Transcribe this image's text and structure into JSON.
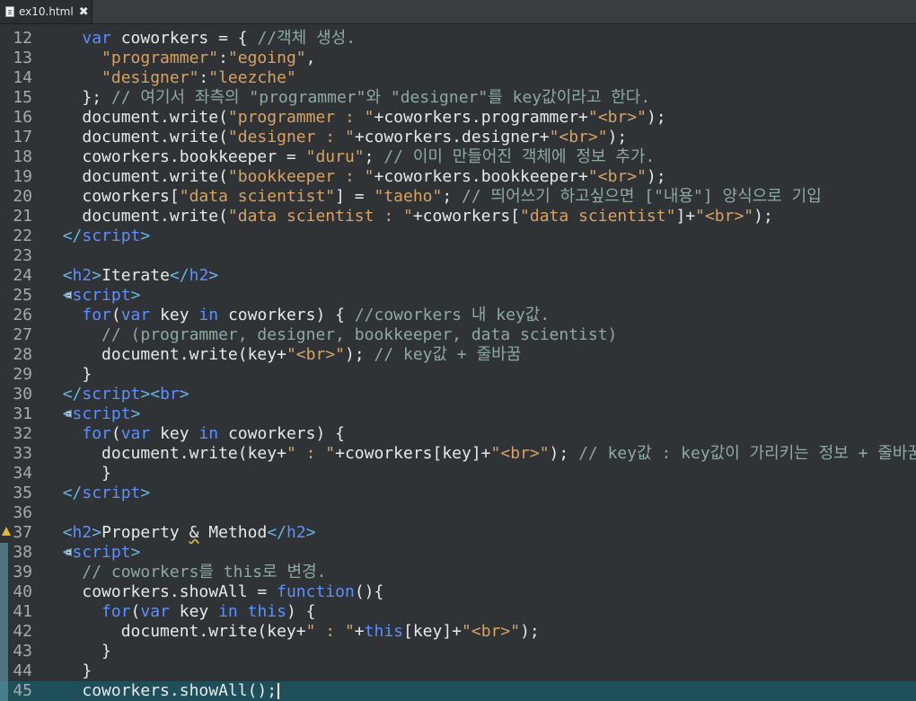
{
  "tab": {
    "title": "ex10.html",
    "close_glyph": "✖"
  },
  "colors": {
    "text": "#e8e8e8",
    "keyword": "#5d8fff",
    "string": "#d7a263",
    "comment": "#8fa8a0",
    "tag": "#64b5e8",
    "line_number": "#a9a9a9",
    "current_line": "#1e4f5a"
  },
  "lines": [
    {
      "num": "12",
      "indent": "    ",
      "tokens": [
        {
          "t": "var",
          "c": "keyword"
        },
        {
          "t": " coworkers = { ",
          "c": "text"
        },
        {
          "t": "//객체 생성.",
          "c": "comment"
        }
      ]
    },
    {
      "num": "13",
      "indent": "      ",
      "tokens": [
        {
          "t": "\"programmer\"",
          "c": "string"
        },
        {
          "t": ":",
          "c": "text"
        },
        {
          "t": "\"egoing\"",
          "c": "string"
        },
        {
          "t": ",",
          "c": "text"
        }
      ]
    },
    {
      "num": "14",
      "indent": "      ",
      "tokens": [
        {
          "t": "\"designer\"",
          "c": "string"
        },
        {
          "t": ":",
          "c": "text"
        },
        {
          "t": "\"leezche\"",
          "c": "string"
        }
      ]
    },
    {
      "num": "15",
      "indent": "    ",
      "tokens": [
        {
          "t": "}; ",
          "c": "text"
        },
        {
          "t": "// 여기서 좌측의 \"programmer\"와 \"designer\"를 key값이라고 한다.",
          "c": "comment"
        }
      ]
    },
    {
      "num": "16",
      "indent": "    ",
      "tokens": [
        {
          "t": "document.write(",
          "c": "text"
        },
        {
          "t": "\"programmer : \"",
          "c": "string"
        },
        {
          "t": "+coworkers.programmer+",
          "c": "text"
        },
        {
          "t": "\"<br>\"",
          "c": "string"
        },
        {
          "t": ");",
          "c": "text"
        }
      ]
    },
    {
      "num": "17",
      "indent": "    ",
      "tokens": [
        {
          "t": "document.write(",
          "c": "text"
        },
        {
          "t": "\"designer : \"",
          "c": "string"
        },
        {
          "t": "+coworkers.designer+",
          "c": "text"
        },
        {
          "t": "\"<br>\"",
          "c": "string"
        },
        {
          "t": ");",
          "c": "text"
        }
      ]
    },
    {
      "num": "18",
      "indent": "    ",
      "tokens": [
        {
          "t": "coworkers.bookkeeper = ",
          "c": "text"
        },
        {
          "t": "\"duru\"",
          "c": "string"
        },
        {
          "t": "; ",
          "c": "text"
        },
        {
          "t": "// 이미 만들어진 객체에 정보 추가.",
          "c": "comment"
        }
      ]
    },
    {
      "num": "19",
      "indent": "    ",
      "tokens": [
        {
          "t": "document.write(",
          "c": "text"
        },
        {
          "t": "\"bookkeeper : \"",
          "c": "string"
        },
        {
          "t": "+coworkers.bookkeeper+",
          "c": "text"
        },
        {
          "t": "\"<br>\"",
          "c": "string"
        },
        {
          "t": ");",
          "c": "text"
        }
      ]
    },
    {
      "num": "20",
      "indent": "    ",
      "tokens": [
        {
          "t": "coworkers[",
          "c": "text"
        },
        {
          "t": "\"data scientist\"",
          "c": "string"
        },
        {
          "t": "] = ",
          "c": "text"
        },
        {
          "t": "\"taeho\"",
          "c": "string"
        },
        {
          "t": "; ",
          "c": "text"
        },
        {
          "t": "// 띄어쓰기 하고싶으면 [\"내용\"] 양식으로 기입",
          "c": "comment"
        }
      ]
    },
    {
      "num": "21",
      "indent": "    ",
      "tokens": [
        {
          "t": "document.write(",
          "c": "text"
        },
        {
          "t": "\"data scientist : \"",
          "c": "string"
        },
        {
          "t": "+coworkers[",
          "c": "text"
        },
        {
          "t": "\"data scientist\"",
          "c": "string"
        },
        {
          "t": "]+",
          "c": "text"
        },
        {
          "t": "\"<br>\"",
          "c": "string"
        },
        {
          "t": ");",
          "c": "text"
        }
      ]
    },
    {
      "num": "22",
      "indent": "  ",
      "tokens": [
        {
          "t": "</",
          "c": "tag"
        },
        {
          "t": "script",
          "c": "keyword"
        },
        {
          "t": ">",
          "c": "tag"
        }
      ]
    },
    {
      "num": "23",
      "indent": "",
      "tokens": []
    },
    {
      "num": "24",
      "indent": "  ",
      "tokens": [
        {
          "t": "<",
          "c": "tag"
        },
        {
          "t": "h2",
          "c": "keyword"
        },
        {
          "t": ">",
          "c": "tag"
        },
        {
          "t": "Iterate",
          "c": "text"
        },
        {
          "t": "</",
          "c": "tag"
        },
        {
          "t": "h2",
          "c": "keyword"
        },
        {
          "t": ">",
          "c": "tag"
        }
      ]
    },
    {
      "num": "25",
      "indent": "  ",
      "fold": true,
      "tokens": [
        {
          "t": "<",
          "c": "tag"
        },
        {
          "t": "script",
          "c": "keyword"
        },
        {
          "t": ">",
          "c": "tag"
        }
      ]
    },
    {
      "num": "26",
      "indent": "    ",
      "tokens": [
        {
          "t": "for",
          "c": "keyword"
        },
        {
          "t": "(",
          "c": "text"
        },
        {
          "t": "var",
          "c": "keyword"
        },
        {
          "t": " key ",
          "c": "text"
        },
        {
          "t": "in",
          "c": "keyword"
        },
        {
          "t": " coworkers) { ",
          "c": "text"
        },
        {
          "t": "//coworkers 내 key값.",
          "c": "comment"
        }
      ]
    },
    {
      "num": "27",
      "indent": "      ",
      "tokens": [
        {
          "t": "// (programmer, designer, bookkeeper, data scientist)",
          "c": "comment"
        }
      ]
    },
    {
      "num": "28",
      "indent": "      ",
      "tokens": [
        {
          "t": "document.write(key+",
          "c": "text"
        },
        {
          "t": "\"<br>\"",
          "c": "string"
        },
        {
          "t": "); ",
          "c": "text"
        },
        {
          "t": "// key값 + 줄바꿈",
          "c": "comment"
        }
      ]
    },
    {
      "num": "29",
      "indent": "    ",
      "tokens": [
        {
          "t": "}",
          "c": "text"
        }
      ]
    },
    {
      "num": "30",
      "indent": "  ",
      "tokens": [
        {
          "t": "</",
          "c": "tag"
        },
        {
          "t": "script",
          "c": "keyword"
        },
        {
          "t": "><",
          "c": "tag"
        },
        {
          "t": "br",
          "c": "keyword"
        },
        {
          "t": ">",
          "c": "tag"
        }
      ]
    },
    {
      "num": "31",
      "indent": "  ",
      "fold": true,
      "tokens": [
        {
          "t": "<",
          "c": "tag"
        },
        {
          "t": "script",
          "c": "keyword"
        },
        {
          "t": ">",
          "c": "tag"
        }
      ]
    },
    {
      "num": "32",
      "indent": "    ",
      "tokens": [
        {
          "t": "for",
          "c": "keyword"
        },
        {
          "t": "(",
          "c": "text"
        },
        {
          "t": "var",
          "c": "keyword"
        },
        {
          "t": " key ",
          "c": "text"
        },
        {
          "t": "in",
          "c": "keyword"
        },
        {
          "t": " coworkers) {",
          "c": "text"
        }
      ]
    },
    {
      "num": "33",
      "indent": "      ",
      "tokens": [
        {
          "t": "document.write(key+",
          "c": "text"
        },
        {
          "t": "\" : \"",
          "c": "string"
        },
        {
          "t": "+coworkers[key]+",
          "c": "text"
        },
        {
          "t": "\"<br>\"",
          "c": "string"
        },
        {
          "t": "); ",
          "c": "text"
        },
        {
          "t": "// key값 : key값이 가리키는 정보 + 줄바꿈",
          "c": "comment"
        }
      ]
    },
    {
      "num": "34",
      "indent": "      ",
      "tokens": [
        {
          "t": "}",
          "c": "text"
        }
      ]
    },
    {
      "num": "35",
      "indent": "  ",
      "tokens": [
        {
          "t": "</",
          "c": "tag"
        },
        {
          "t": "script",
          "c": "keyword"
        },
        {
          "t": ">",
          "c": "tag"
        }
      ]
    },
    {
      "num": "36",
      "indent": "",
      "tokens": []
    },
    {
      "num": "37",
      "indent": "  ",
      "warning": true,
      "tokens": [
        {
          "t": "<",
          "c": "tag"
        },
        {
          "t": "h2",
          "c": "keyword"
        },
        {
          "t": ">",
          "c": "tag"
        },
        {
          "t": "Property ",
          "c": "text"
        },
        {
          "t": "&",
          "c": "text",
          "u": true
        },
        {
          "t": " Method",
          "c": "text"
        },
        {
          "t": "</",
          "c": "tag"
        },
        {
          "t": "h2",
          "c": "keyword"
        },
        {
          "t": ">",
          "c": "tag"
        }
      ]
    },
    {
      "num": "38",
      "indent": "  ",
      "fold": true,
      "changed": true,
      "tokens": [
        {
          "t": "<",
          "c": "tag"
        },
        {
          "t": "script",
          "c": "keyword"
        },
        {
          "t": ">",
          "c": "tag"
        }
      ]
    },
    {
      "num": "39",
      "indent": "    ",
      "changed": true,
      "tokens": [
        {
          "t": "// coworkers를 this로 변경.",
          "c": "comment"
        }
      ]
    },
    {
      "num": "40",
      "indent": "    ",
      "changed": true,
      "tokens": [
        {
          "t": "coworkers.showAll = ",
          "c": "text"
        },
        {
          "t": "function",
          "c": "keyword"
        },
        {
          "t": "(){",
          "c": "text"
        }
      ]
    },
    {
      "num": "41",
      "indent": "      ",
      "changed": true,
      "tokens": [
        {
          "t": "for",
          "c": "keyword"
        },
        {
          "t": "(",
          "c": "text"
        },
        {
          "t": "var",
          "c": "keyword"
        },
        {
          "t": " key ",
          "c": "text"
        },
        {
          "t": "in",
          "c": "keyword"
        },
        {
          "t": " ",
          "c": "text"
        },
        {
          "t": "this",
          "c": "keyword"
        },
        {
          "t": ") {",
          "c": "text"
        }
      ]
    },
    {
      "num": "42",
      "indent": "        ",
      "changed": true,
      "tokens": [
        {
          "t": "document.write(key+",
          "c": "text"
        },
        {
          "t": "\" : \"",
          "c": "string"
        },
        {
          "t": "+",
          "c": "text"
        },
        {
          "t": "this",
          "c": "keyword"
        },
        {
          "t": "[key]+",
          "c": "text"
        },
        {
          "t": "\"<br>\"",
          "c": "string"
        },
        {
          "t": ");",
          "c": "text"
        }
      ]
    },
    {
      "num": "43",
      "indent": "      ",
      "changed": true,
      "tokens": [
        {
          "t": "}",
          "c": "text"
        }
      ]
    },
    {
      "num": "44",
      "indent": "    ",
      "changed": true,
      "tokens": [
        {
          "t": "}",
          "c": "text"
        }
      ]
    },
    {
      "num": "45",
      "indent": "    ",
      "changed": true,
      "current": true,
      "tokens": [
        {
          "t": "coworkers.showAll();",
          "c": "text"
        }
      ]
    }
  ]
}
